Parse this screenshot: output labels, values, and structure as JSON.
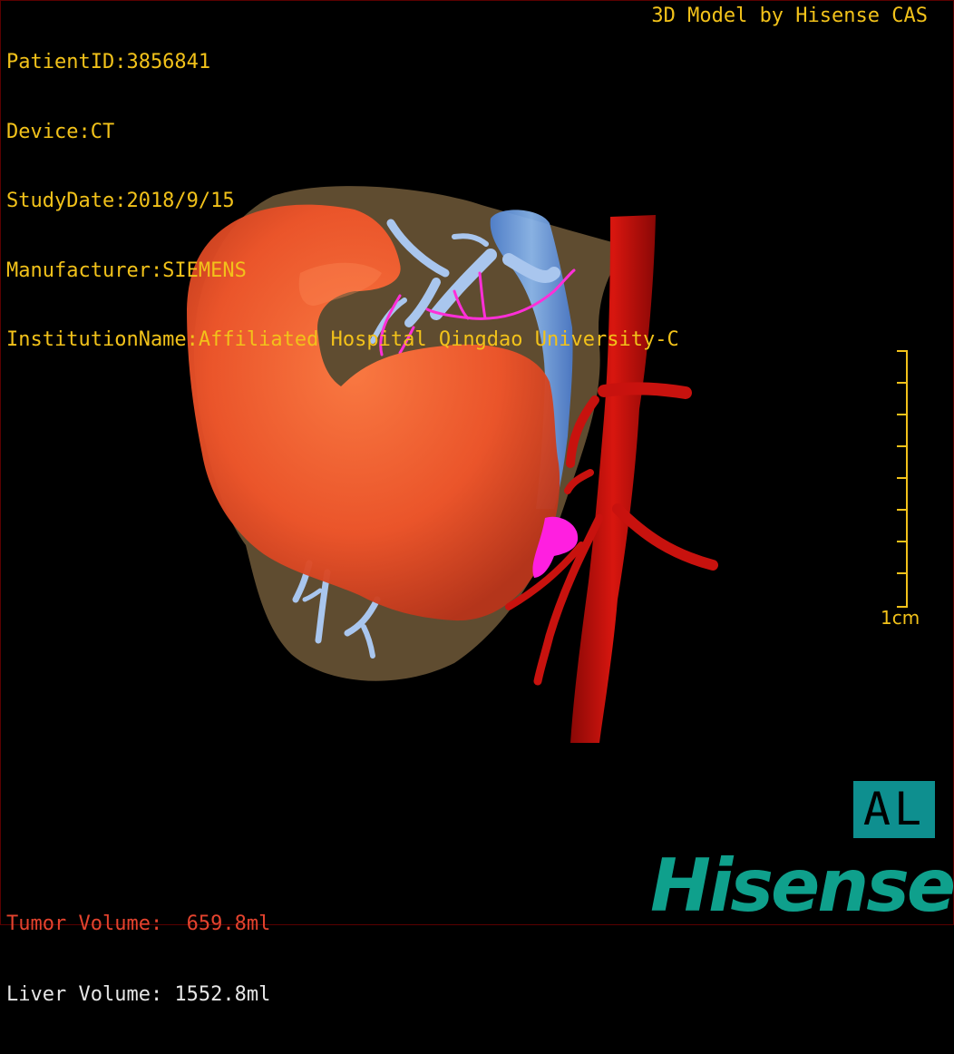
{
  "patient_info": {
    "patient_id": "PatientID:3856841",
    "device": "Device:CT",
    "study_date": "StudyDate:2018/9/15",
    "manufacturer": "Manufacturer:SIEMENS",
    "institution": "InstitutionName:Affiliated Hospital Qingdao University-C"
  },
  "credit": "3D Model by Hisense CAS",
  "scale_bar": {
    "label": "1cm",
    "ticks": 9
  },
  "orientation": "AL",
  "volumes": {
    "tumor": "Tumor Volume:  659.8ml",
    "liver": "Liver Volume: 1552.8ml"
  },
  "brand": "Hisense",
  "colors": {
    "text_info": "#f2c21a",
    "tumor_text": "#e4432e",
    "tumor_surface": "#f0552a",
    "liver_surface": "#9a7a4e",
    "artery": "#c8120e",
    "vein": "#8fb4e6",
    "portal_vein": "#6fa8f0",
    "bile_duct": "#ff2fd8",
    "brand": "#0fa08c",
    "orientation_badge": "#0e8f8f"
  },
  "structures": [
    "liver",
    "tumor",
    "inferior-vena-cava",
    "aorta",
    "hepatic-veins",
    "bile-ducts",
    "portal-vein-branches"
  ]
}
